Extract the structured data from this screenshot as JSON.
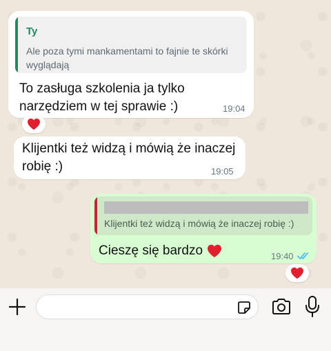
{
  "messages": {
    "m1": {
      "quote_author": "Ty",
      "quote_line1": "Ale poza tymi mankamentami to fajnie te skórki",
      "quote_line2": "wyglądają",
      "line1": "To zasługa szkolenia ja tylko",
      "line2": "narzędziem w tej sprawie :)",
      "time": "19:04",
      "reaction": "heart"
    },
    "m2": {
      "line1": "Klijentki też widzą i mówią że inaczej",
      "line2": "robię :)",
      "time": "19:05"
    },
    "m3": {
      "quote_text": "Klijentki też widzą i mówią że inaczej robię :)",
      "text": "Cieszę się bardzo",
      "emoji": "heart",
      "time": "19:40",
      "status": "read",
      "reaction": "heart"
    }
  },
  "colors": {
    "quote_bar_green": "#1f8a5e",
    "quote_bar_red": "#c0263a",
    "quote_author": "#1f8a5e",
    "read_ticks": "#53bdeb",
    "heart": "#e0202f"
  },
  "composer": {
    "icons": [
      "plus-icon",
      "sticker-icon",
      "camera-icon",
      "microphone-icon"
    ]
  }
}
